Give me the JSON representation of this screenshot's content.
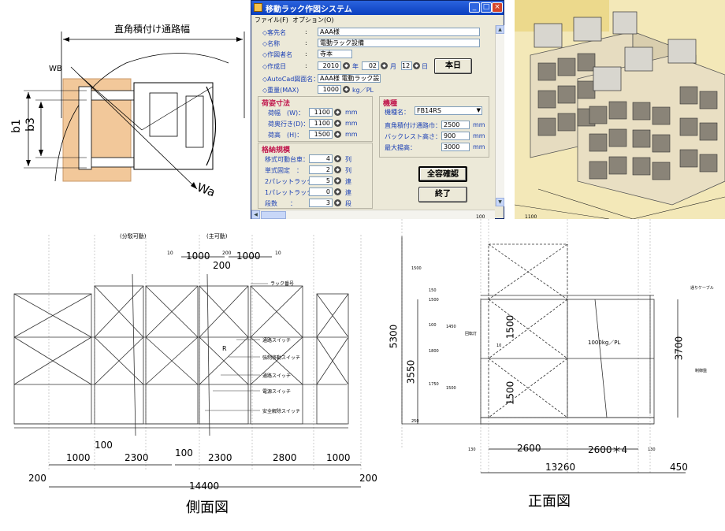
{
  "turn_diagram": {
    "aisle_label": "直角積付け通路幅",
    "labels": [
      "WB",
      "b1",
      "b3",
      "Wa"
    ]
  },
  "window": {
    "title": "移動ラック作図システム",
    "title_buttons": [
      "_",
      "□",
      "×"
    ],
    "menu": [
      "ファイル(F)",
      "オプション(O)"
    ],
    "fields": {
      "customer_label": "◇客先名",
      "customer_value": "AAA様",
      "name_label": "◇名称",
      "name_value": "電動ラック設備",
      "author_label": "◇作図者名",
      "author_value": "寺本",
      "date_label": "◇作成日",
      "year": "2010",
      "year_unit": "年",
      "month": "02",
      "month_unit": "月",
      "day": "12",
      "day_unit": "日",
      "autocad_label": "◇AutoCad図面名：",
      "autocad_value": "AAA様 電動ラック設",
      "weight_label": "◇重量(MAX)",
      "weight_value": "1000",
      "weight_unit": "kg／PL",
      "colon": ":"
    },
    "today_button": "本日",
    "load_section": {
      "title": "荷姿寸法",
      "rows": [
        {
          "label": "荷幅　(W)：",
          "value": "1100",
          "unit": "mm"
        },
        {
          "label": "荷奥行き(D)：",
          "value": "1100",
          "unit": "mm"
        },
        {
          "label": "荷高　(H)：",
          "value": "1500",
          "unit": "mm"
        }
      ]
    },
    "storage_section": {
      "title": "格納規模",
      "rows": [
        {
          "label": "移式可動台車：",
          "value": "4",
          "unit": "列"
        },
        {
          "label": "単式固定　：",
          "value": "2",
          "unit": "列"
        },
        {
          "label": "2パレットラック：",
          "value": "5",
          "unit": "連"
        },
        {
          "label": "1パレットラック：",
          "value": "0",
          "unit": "連"
        },
        {
          "label": "段数　　：",
          "value": "3",
          "unit": "段"
        }
      ]
    },
    "model_section": {
      "title": "機種",
      "model_label": "機種名：",
      "model_value": "FB14RS",
      "rows": [
        {
          "label": "直角積付け通路巾：",
          "value": "2500",
          "unit": "mm"
        },
        {
          "label": "バックレスト高さ：",
          "value": "900",
          "unit": "mm"
        },
        {
          "label": "最大揚高：",
          "value": "3000",
          "unit": "mm"
        }
      ]
    },
    "confirm_button": "全容確認",
    "exit_button": "終了"
  },
  "side_view": {
    "caption": "側面図",
    "top_labels": [
      "(分駁可動)",
      "(主可動)"
    ],
    "top_dims": [
      "10",
      "1000",
      "200",
      "1000",
      "10",
      "200"
    ],
    "callouts": [
      "ラック番号",
      "通路スイッチ",
      "強制移動スイッチ",
      "通路スイッチ",
      "電源スイッチ",
      "安全解除スイッチ"
    ],
    "small_mark": "R",
    "bottom_dims": [
      "1000",
      "100",
      "2300",
      "100",
      "2300",
      "2800",
      "1000"
    ],
    "overall": [
      "200",
      "14400",
      "200"
    ]
  },
  "front_view": {
    "caption": "正面図",
    "top_dims": [
      "100",
      "1100"
    ],
    "left_dims": [
      "1500",
      "150",
      "1500",
      "1450",
      "1750",
      "1500",
      "100",
      "1800",
      "250"
    ],
    "big_dims": [
      "5300",
      "3550"
    ],
    "inner_dims": [
      "1500",
      "1500"
    ],
    "right_dim": "3700",
    "labels": [
      "通りケーブル",
      "制御盤",
      "回転灯",
      "1000kg／PL",
      "10"
    ],
    "bottom_dims": [
      "130",
      "2600",
      "2600＊4",
      "130",
      "13260",
      "450"
    ]
  }
}
